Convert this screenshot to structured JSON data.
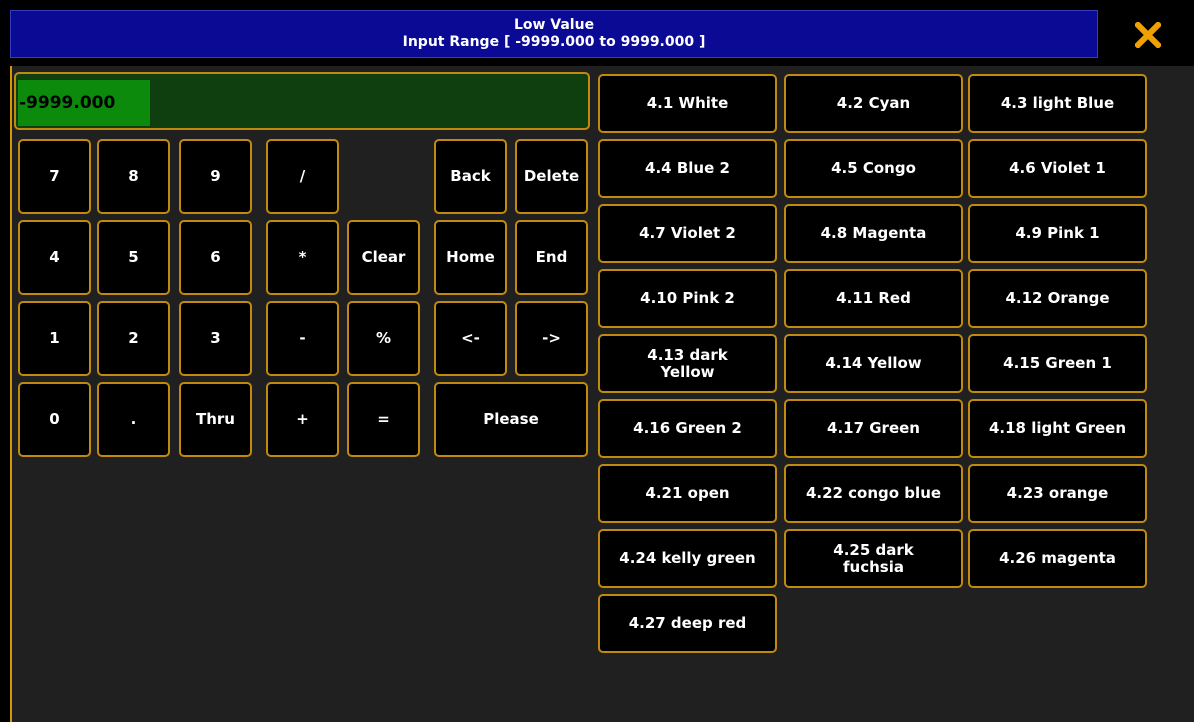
{
  "title": {
    "line1": "Low Value",
    "line2": "Input Range [ -9999.000 to 9999.000 ]"
  },
  "close_icon": "close-x-icon",
  "colors": {
    "title_bg": "#0a0a94",
    "accent_border": "#c08a10",
    "input_bg": "#0f3f0f",
    "input_highlight": "#0b8a0b",
    "close_icon": "#f0a000"
  },
  "input": {
    "value": "-9999.000"
  },
  "keypad": {
    "k7": "7",
    "k8": "8",
    "k9": "9",
    "div": "/",
    "back": "Back",
    "delete": "Delete",
    "k4": "4",
    "k5": "5",
    "k6": "6",
    "mul": "*",
    "clear": "Clear",
    "home": "Home",
    "end": "End",
    "k1": "1",
    "k2": "2",
    "k3": "3",
    "minus": "-",
    "percent": "%",
    "left": "<-",
    "right": "->",
    "k0": "0",
    "dot": ".",
    "thru": "Thru",
    "plus": "+",
    "equals": "=",
    "please": "Please"
  },
  "presets": [
    "4.1 White",
    "4.2 Cyan",
    "4.3 light Blue",
    "4.4 Blue 2",
    "4.5 Congo",
    "4.6 Violet 1",
    "4.7 Violet 2",
    "4.8 Magenta",
    "4.9 Pink 1",
    "4.10 Pink 2",
    "4.11 Red",
    "4.12 Orange",
    "4.13 dark Yellow",
    "4.14 Yellow",
    "4.15 Green 1",
    "4.16 Green 2",
    "4.17 Green",
    "4.18 light Green",
    "4.21 open",
    "4.22 congo blue",
    "4.23 orange",
    "4.24 kelly green",
    "4.25 dark fuchsia",
    "4.26 magenta",
    "4.27 deep red"
  ]
}
